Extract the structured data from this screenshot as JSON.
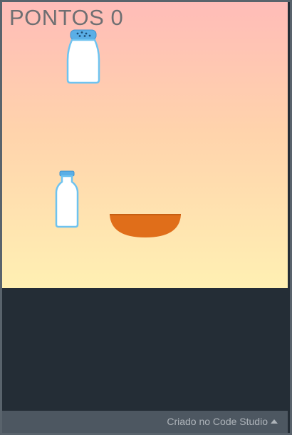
{
  "game": {
    "score_label": "PONTOS 0",
    "sprites": [
      "salt-shaker",
      "milk-bottle",
      "mixing-bowl"
    ]
  },
  "footer": {
    "credit_label": "Criado no Code Studio",
    "caret_icon": "caret-up-icon"
  },
  "colors": {
    "sky_top": "#ffbcb8",
    "sky_bottom": "#fff0b3",
    "bowl": "#e06e1a",
    "item_outline": "#6ec3f0",
    "panel": "#242d36",
    "footer": "#4d5761"
  }
}
